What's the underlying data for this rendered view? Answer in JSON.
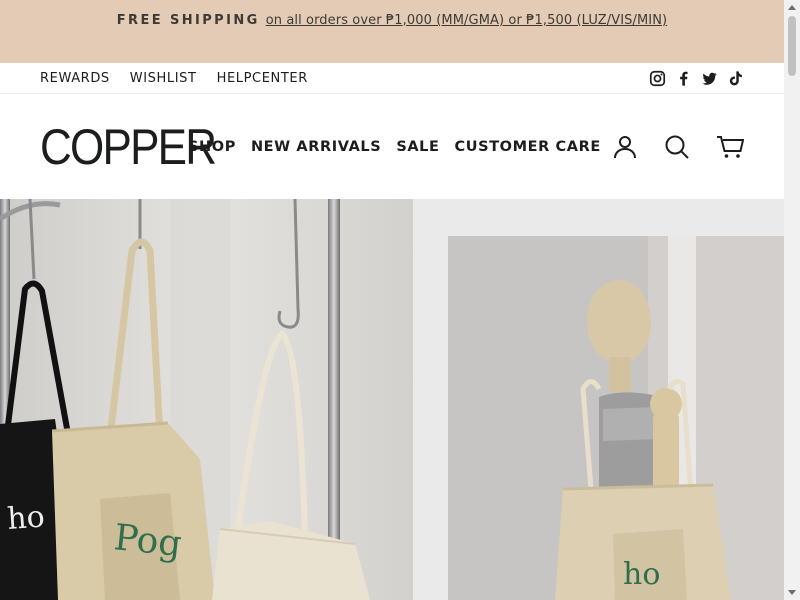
{
  "announcement": {
    "strong": "FREE SHIPPING",
    "link": "on all orders over ₱1,000 (MM/GMA) or ₱1,500 (LUZ/VIS/MIN)"
  },
  "utility": {
    "links": [
      "REWARDS",
      "WISHLIST",
      "HELPCENTER"
    ],
    "social": [
      "instagram-icon",
      "facebook-icon",
      "twitter-icon",
      "tiktok-icon"
    ]
  },
  "header": {
    "logo": "COPPER",
    "nav": [
      "SHOP",
      "NEW ARRIVALS",
      "SALE",
      "CUSTOMER CARE"
    ],
    "icons": [
      "account-icon",
      "search-icon",
      "cart-icon"
    ]
  },
  "hero": {
    "left_image": "tote bags hanging on rack",
    "right_image": "mannequin with tote bag",
    "bag_prints": [
      "ho",
      "Pog",
      "ho"
    ]
  },
  "colors": {
    "announcement_bg": "#e3cbb5",
    "text": "#1c1d1d",
    "tote_canvas": "#d8c8a6",
    "print_green": "#2f6f4e"
  }
}
